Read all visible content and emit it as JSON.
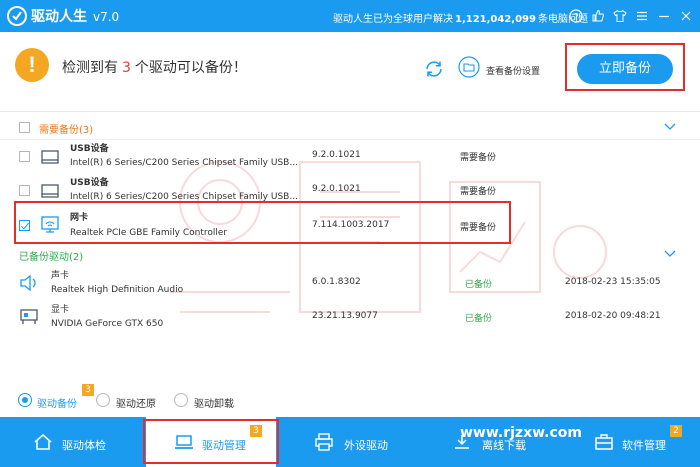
{
  "titlebar": {
    "app_name": "驱动人生",
    "version": "v7.0",
    "notice_prefix": "驱动人生已为全球用户解决",
    "notice_count": "1,121,042,099",
    "notice_suffix": "条电脑问题",
    "icons": [
      "help-icon",
      "like-icon",
      "shirt-icon",
      "menu-icon",
      "minimize-icon",
      "close-icon"
    ]
  },
  "header": {
    "msg_prefix": "检测到有",
    "msg_count": "3",
    "msg_suffix": "个驱动可以备份！",
    "settings_link": "查看备份设置",
    "backup_button": "立即备份"
  },
  "groups": {
    "need_backup": {
      "title": "需要备份(3)",
      "items": [
        {
          "icon": "usb-drive-icon",
          "name": "USB设备",
          "desc": "Intel(R) 6 Series/C200 Series Chipset Family USB...",
          "version": "9.2.0.1021",
          "status": "需要备份",
          "checked": false
        },
        {
          "icon": "usb-drive-icon",
          "name": "USB设备",
          "desc": "Intel(R) 6 Series/C200 Series Chipset Family USB...",
          "version": "9.2.0.1021",
          "status": "需要备份",
          "checked": false
        },
        {
          "icon": "network-card-icon",
          "name": "网卡",
          "desc": "Realtek PCIe GBE Family Controller",
          "version": "7.114.1003.2017",
          "status": "需要备份",
          "checked": true
        }
      ]
    },
    "backed_up": {
      "title": "已备份驱动(2)",
      "items": [
        {
          "icon": "speaker-icon",
          "name": "声卡",
          "desc": "Realtek High Definition Audio",
          "version": "6.0.1.8302",
          "status": "已备份",
          "date": "2018-02-23 15:35:05"
        },
        {
          "icon": "display-card-icon",
          "name": "显卡",
          "desc": "NVIDIA GeForce GTX 650",
          "version": "23.21.13.9077",
          "status": "已备份",
          "date": "2018-02-20 09:48:21"
        }
      ]
    }
  },
  "modes": {
    "options": [
      "驱动备份",
      "驱动还原",
      "驱动卸载"
    ],
    "selected": "驱动备份",
    "backup_badge": "3"
  },
  "bottom_tabs": [
    {
      "label": "驱动体检",
      "icon": "home-icon"
    },
    {
      "label": "驱动管理",
      "icon": "laptop-icon",
      "badge": "3",
      "active": true
    },
    {
      "label": "外设驱动",
      "icon": "printer-icon"
    },
    {
      "label": "离线下载",
      "icon": "download-icon"
    },
    {
      "label": "软件管理",
      "icon": "briefcase-icon",
      "badge": "2"
    }
  ],
  "watermark_site": "www.rjzxw.com",
  "colors": {
    "accent": "#1a9bf0",
    "warning": "#f5a623",
    "need_backup": "#e8771c",
    "backed_up": "#2ea84a",
    "highlight_box": "#e52d2d"
  }
}
